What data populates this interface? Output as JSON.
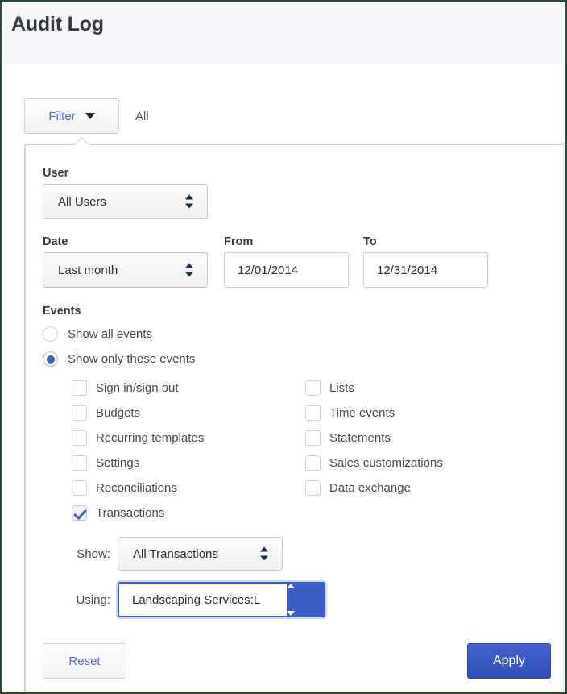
{
  "header": {
    "title": "Audit Log"
  },
  "filter_bar": {
    "button_label": "Filter",
    "caret_icon": "chevron-down-icon",
    "status_label": "All"
  },
  "panel": {
    "user": {
      "label": "User",
      "selected": "All Users"
    },
    "date": {
      "label": "Date",
      "selected": "Last month"
    },
    "from": {
      "label": "From",
      "value": "12/01/2014"
    },
    "to": {
      "label": "To",
      "value": "12/31/2014"
    },
    "events": {
      "label": "Events",
      "radios": [
        {
          "label": "Show all events",
          "checked": false
        },
        {
          "label": "Show only these events",
          "checked": true
        }
      ],
      "checkboxes_left": [
        {
          "label": "Sign in/sign out",
          "checked": false
        },
        {
          "label": "Budgets",
          "checked": false
        },
        {
          "label": "Recurring templates",
          "checked": false
        },
        {
          "label": "Settings",
          "checked": false
        },
        {
          "label": "Reconciliations",
          "checked": false
        },
        {
          "label": "Transactions",
          "checked": true
        }
      ],
      "checkboxes_right": [
        {
          "label": "Lists",
          "checked": false
        },
        {
          "label": "Time events",
          "checked": false
        },
        {
          "label": "Statements",
          "checked": false
        },
        {
          "label": "Sales customizations",
          "checked": false
        },
        {
          "label": "Data exchange",
          "checked": false
        }
      ]
    },
    "show": {
      "label": "Show:",
      "selected": "All Transactions"
    },
    "using": {
      "label": "Using:",
      "selected": "Landscaping Services:L"
    },
    "reset_label": "Reset",
    "apply_label": "Apply"
  },
  "colors": {
    "accent_blue": "#3c5fc4",
    "link_blue": "#4a6ee0",
    "header_bg": "#f5f7fa",
    "frame_border": "#2e4a36"
  }
}
